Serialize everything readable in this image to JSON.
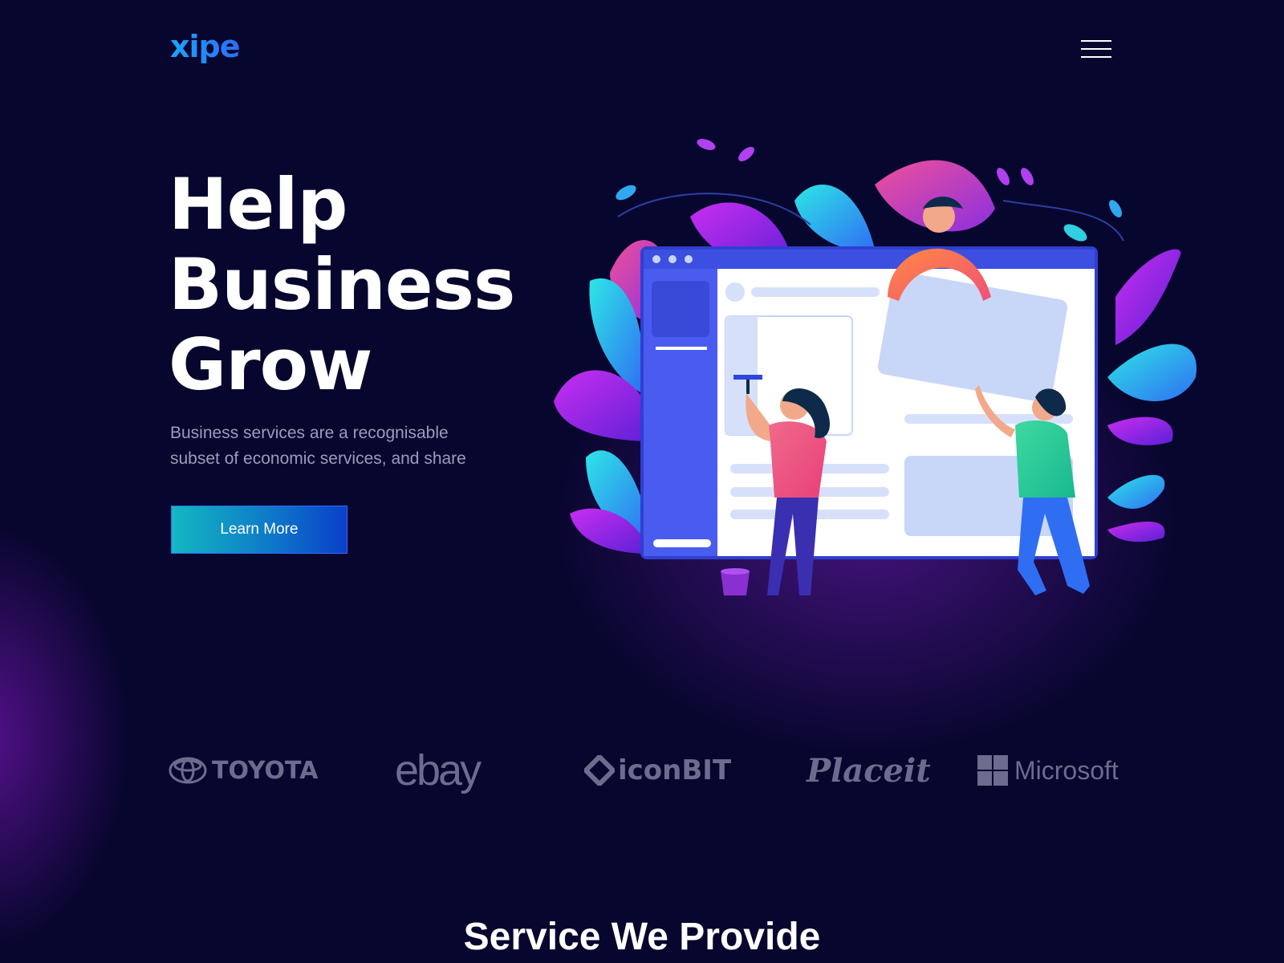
{
  "header": {
    "logo_text": "xipe",
    "menu_icon": "hamburger-menu-icon"
  },
  "hero": {
    "title_lines": [
      "Help",
      "Business",
      "Grow"
    ],
    "subtitle_line1": "Business services are a recognisable",
    "subtitle_line2": "subset of economic services, and share",
    "cta_label": "Learn More"
  },
  "illustration": {
    "description_icon": "team-building-website-illustration",
    "colors": {
      "window": "#4a5cf0",
      "leaf_purple": "#a020e8",
      "leaf_cyan": "#1fd0e0",
      "leaf_pink": "#e2407a"
    }
  },
  "partners": {
    "toyota": "TOYOTA",
    "ebay": "ebay",
    "iconbit": "iconBIT",
    "placeit": "Placeit",
    "microsoft": "Microsoft"
  },
  "services": {
    "title": "Service We Provide"
  },
  "colors": {
    "background": "#07062e",
    "accent_blue": "#2d6cf6",
    "accent_teal": "#13b8c1",
    "muted_text": "#9b9cbc",
    "logo_gray": "#6c6c8f"
  }
}
